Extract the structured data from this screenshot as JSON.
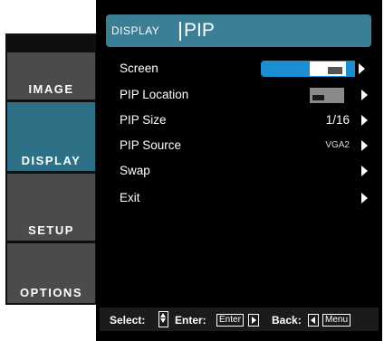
{
  "tabs": [
    {
      "label": "IMAGE",
      "active": false
    },
    {
      "label": "DISPLAY",
      "active": true
    },
    {
      "label": "SETUP",
      "active": false
    },
    {
      "label": "OPTIONS",
      "active": false
    }
  ],
  "header": {
    "section": "DISPLAY",
    "page": "PIP"
  },
  "menu": {
    "screen": {
      "label": "Screen"
    },
    "pip_location": {
      "label": "PIP Location"
    },
    "pip_size": {
      "label": "PIP Size",
      "value": "1/16"
    },
    "pip_source": {
      "label": "PIP Source",
      "value": "VGA2"
    },
    "swap": {
      "label": "Swap"
    },
    "exit": {
      "label": "Exit"
    }
  },
  "help": {
    "select_label": "Select:",
    "enter_label": "Enter:",
    "enter_key": "Enter",
    "back_label": "Back:",
    "menu_key": "Menu"
  },
  "colors": {
    "accent": "#3a7f95",
    "tab_active": "#2e7186",
    "tab_inactive": "#4b4b4c",
    "highlight": "#1b8fd1",
    "panel_bg": "#000000"
  }
}
